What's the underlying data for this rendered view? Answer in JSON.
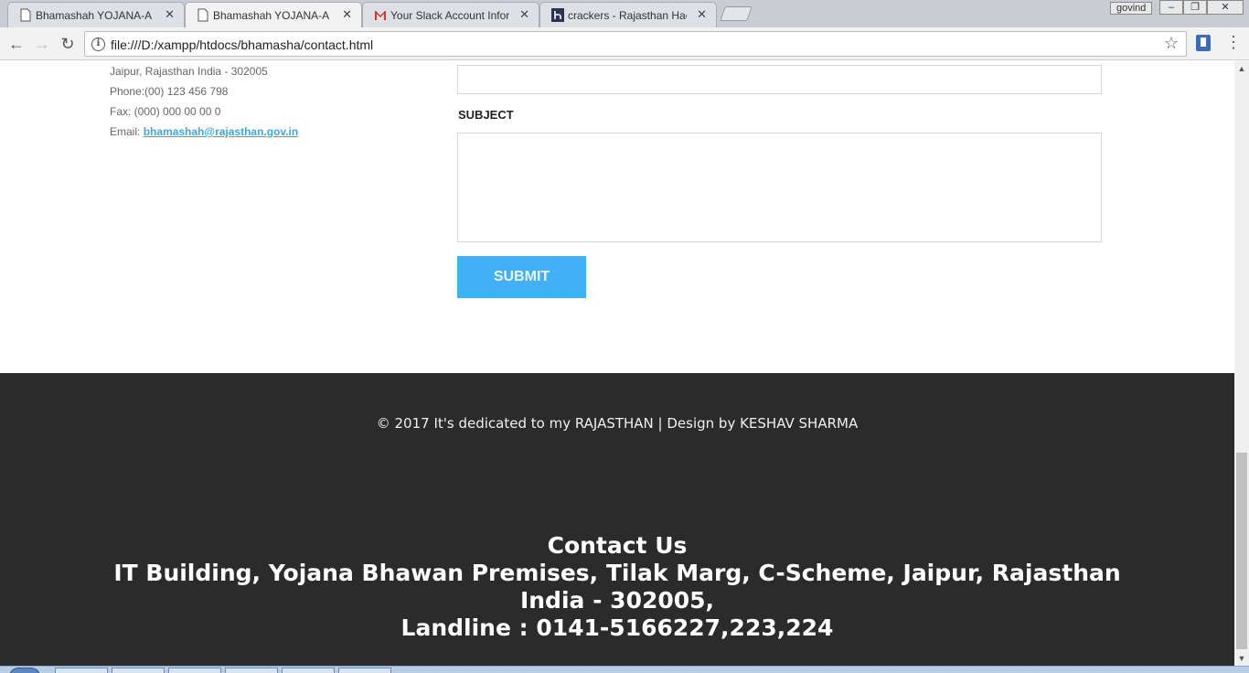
{
  "browser": {
    "tabs": [
      {
        "title": "Bhamashah YOJANA-A M",
        "icon": "page-icon",
        "active": false
      },
      {
        "title": "Bhamashah YOJANA-A M",
        "icon": "page-icon",
        "active": true
      },
      {
        "title": "Your Slack Account Infor",
        "icon": "gmail-icon",
        "active": false
      },
      {
        "title": "crackers - Rajasthan Hac",
        "icon": "hackerearth-icon",
        "active": false
      }
    ],
    "profile_name": "govind",
    "url": "file:///D:/xampp/htdocs/bhamasha/contact.html"
  },
  "contact_info": {
    "address_line": "Jaipur, Rajasthan India - 302005",
    "phone": "Phone:(00) 123 456 798",
    "fax": "Fax: (000) 000 00 00 0",
    "email_prefix": "Email: ",
    "email": "bhamashah@rajasthan.gov.in"
  },
  "form": {
    "subject_label": "SUBJECT",
    "submit_label": "SUBMIT"
  },
  "footer": {
    "copyright": "© 2017 It's dedicated to my RAJASTHAN | Design by KESHAV SHARMA",
    "contact_heading": "Contact Us",
    "address": "IT Building, Yojana Bhawan Premises, Tilak Marg, C-Scheme, Jaipur, Rajasthan India - 302005,",
    "landline": "Landline : 0141-5166227,223,224"
  },
  "colors": {
    "submit_button": "#41b1f7",
    "footer_bg": "#2b2b2b",
    "link": "#3aa8e6"
  }
}
